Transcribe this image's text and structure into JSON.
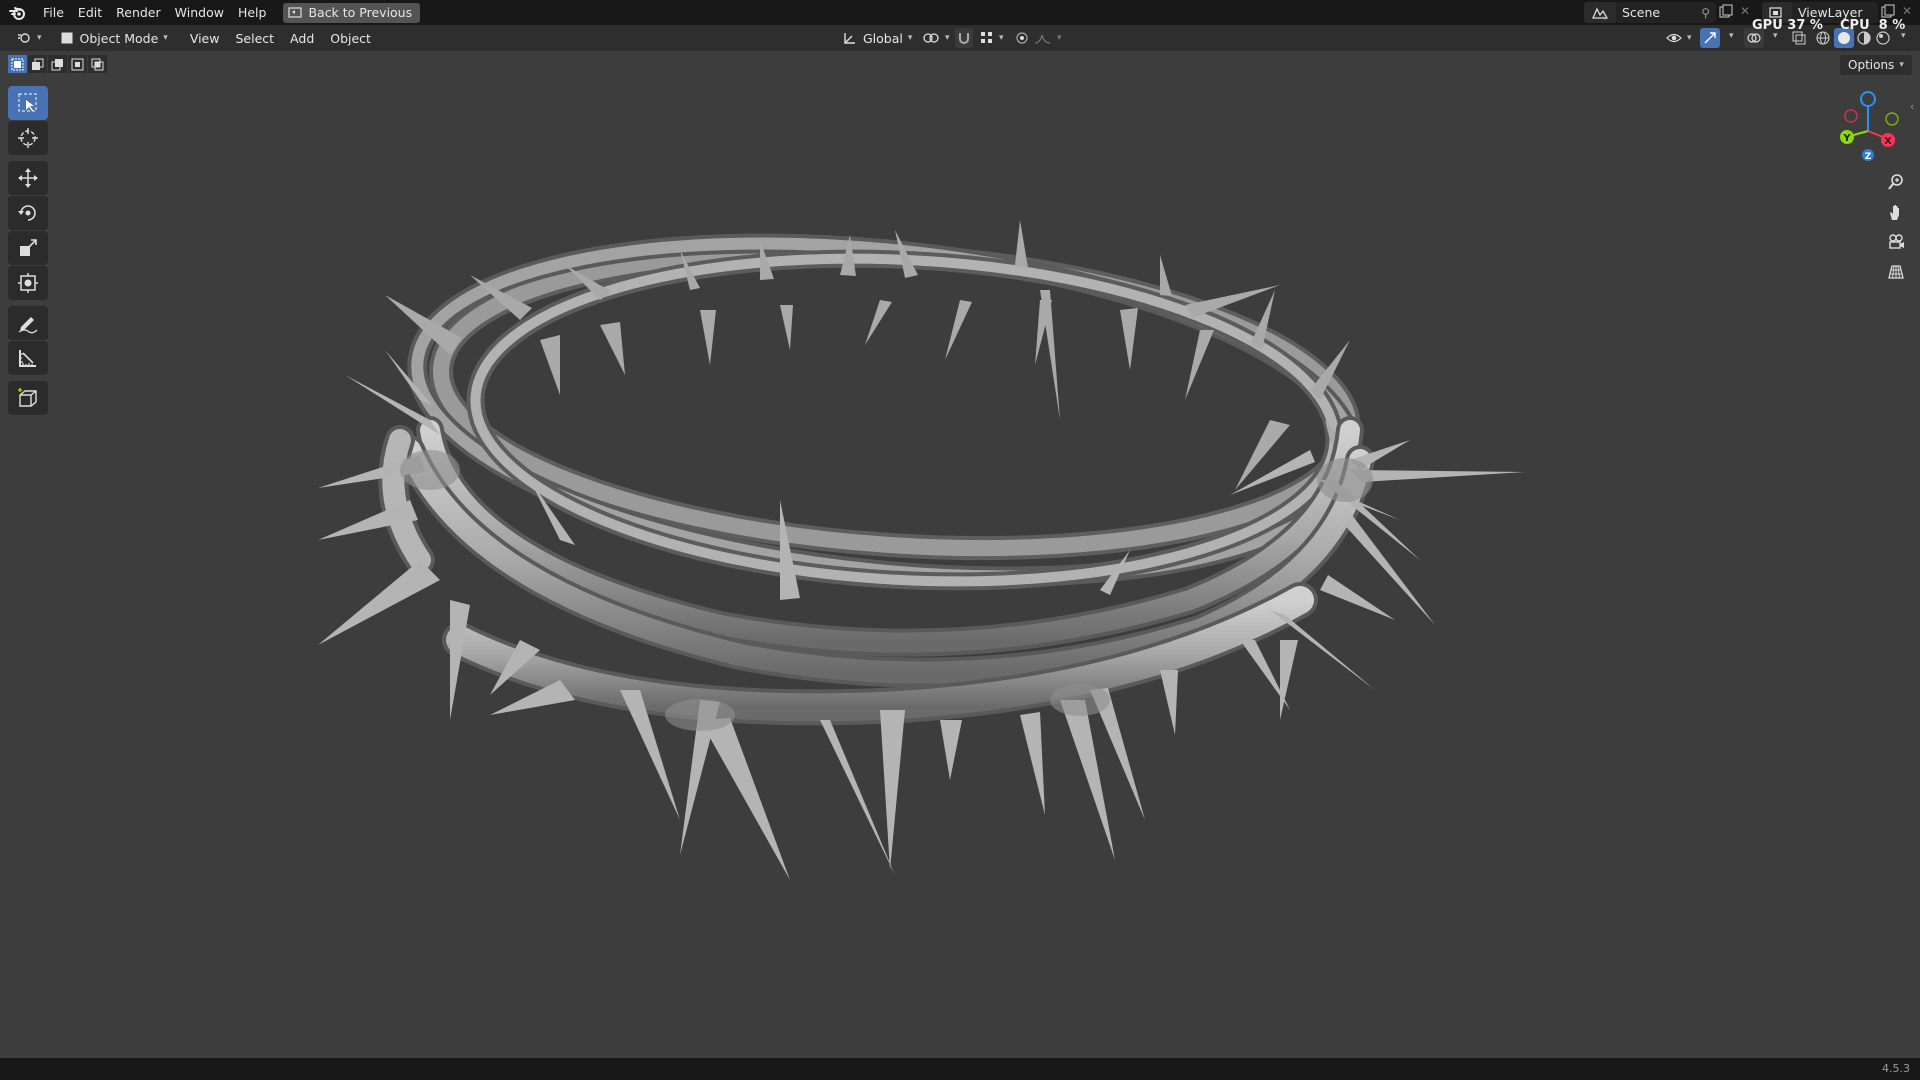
{
  "topbar": {
    "menus": [
      "File",
      "Edit",
      "Render",
      "Window",
      "Help"
    ],
    "back_button": "Back to Previous",
    "scene_name": "Scene",
    "view_layer": "ViewLayer"
  },
  "header": {
    "mode": "Object Mode",
    "menus": [
      "View",
      "Select",
      "Add",
      "Object"
    ],
    "transform_orientation": "Global"
  },
  "stats": {
    "gpu": "GPU 37 %",
    "cpu": "CPU  8 %"
  },
  "viewport": {
    "options_label": "Options",
    "gizmo_axes": [
      "X",
      "Y",
      "Z"
    ]
  },
  "toolbar": {
    "tools": [
      "select-box",
      "cursor",
      "move",
      "rotate",
      "scale",
      "transform",
      "annotate",
      "measure",
      "add-cube"
    ],
    "active_tool": "select-box"
  },
  "statusbar": {
    "version": "4.5.3"
  },
  "colors": {
    "accent": "#4772b3",
    "background": "#3d3d3d",
    "axis_x": "#ff3352",
    "axis_y": "#8bdc00",
    "axis_z": "#2890ff"
  }
}
